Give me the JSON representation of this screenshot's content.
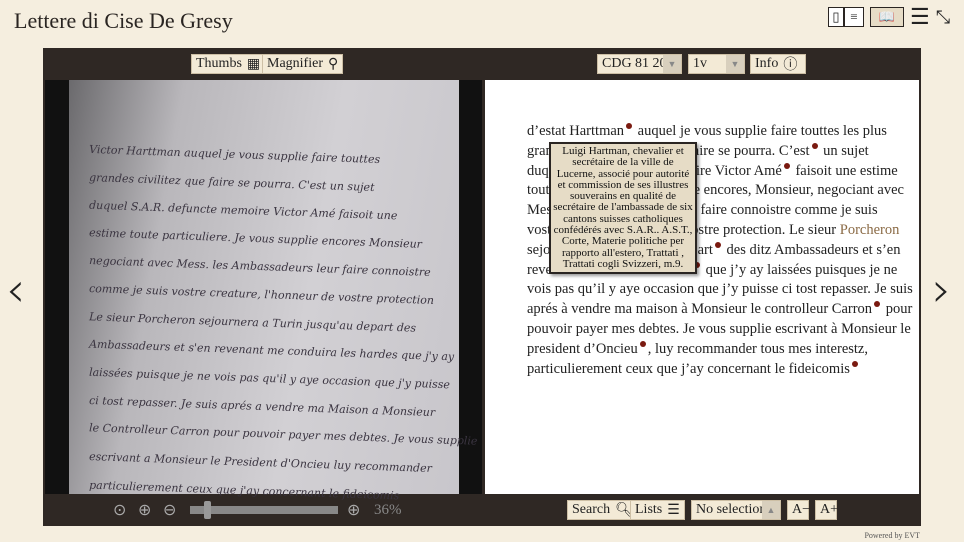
{
  "app": {
    "title": "Lettere di Cise De Gresy",
    "powered_by": "Powered by EVT"
  },
  "top_icons": [
    "single-page-icon",
    "text-page-icon",
    "book-icon",
    "menu-icon",
    "collapse-icon"
  ],
  "toolbar": {
    "thumbs": "Thumbs",
    "magnifier": "Magnifier",
    "document": "CDG 81 20",
    "page": "1v",
    "info": "Info"
  },
  "image": {
    "zoom": "36%",
    "zoom_level": 36
  },
  "text": {
    "lines": [
      [
        "d’estat Harttman",
        "dot",
        " auquel je vous supplie faire touttes les plus"
      ],
      [
        "gran",
        "gap",
        "aire se pourra. C’est",
        "dot",
        " un sujet"
      ],
      [
        "duq",
        "gap",
        "oire Victor Amé",
        "dot",
        " faisoit une estime"
      ],
      [
        "tout",
        "gap",
        "ie encores, Monsieur, negociant avec"
      ],
      [
        "Mes",
        "gap",
        "r faire connoistre comme je suis"
      ],
      [
        "vost",
        "gap",
        "ostre protection. Le sieur ",
        "link:Porcheron"
      ],
      [
        "sejo",
        "gap",
        "part",
        "dot",
        " des ditz Ambassadeurs et s’en"
      ],
      [
        "reve",
        "gap",
        "dot",
        " que j’y ay laissées puisques je ne"
      ],
      [
        "vois pas qu’il y aye occasion que j’y puisse ci tost repasser. Je suis"
      ],
      [
        "aprés à vendre ma maison à Monsieur le controlleur Carron",
        "dot",
        " pour"
      ],
      [
        "pouvoir payer mes debtes. Je vous supplie escrivant à Monsieur le"
      ],
      [
        "president d’Oncieu",
        "dot",
        ", luy recommander tous mes interestz,"
      ],
      [
        "particulierement ceux que j’ay concernant le fideicomis",
        "dot"
      ]
    ],
    "tooltip": "Luigi Hartman, chevalier et secrétaire de la ville de Lucerne, associé pour autorité et commission de ses illustres souverains en qualité de secrétaire de l'ambassade de six cantons suisses catholiques confédérés avec S.A.R.. A.S.T., Corte, Materie politiche per rapporto all'estero, Trattati , Trattati cogli Svizzeri, m.9."
  },
  "bottom": {
    "search": "Search",
    "lists": "Lists",
    "selection": "No selection",
    "font_decrease": "A−",
    "font_increase": "A+"
  },
  "colors": {
    "frame": "#2f2824",
    "background": "#f5eedf",
    "note_dot": "#7a1a10",
    "link": "#8a6a45"
  }
}
